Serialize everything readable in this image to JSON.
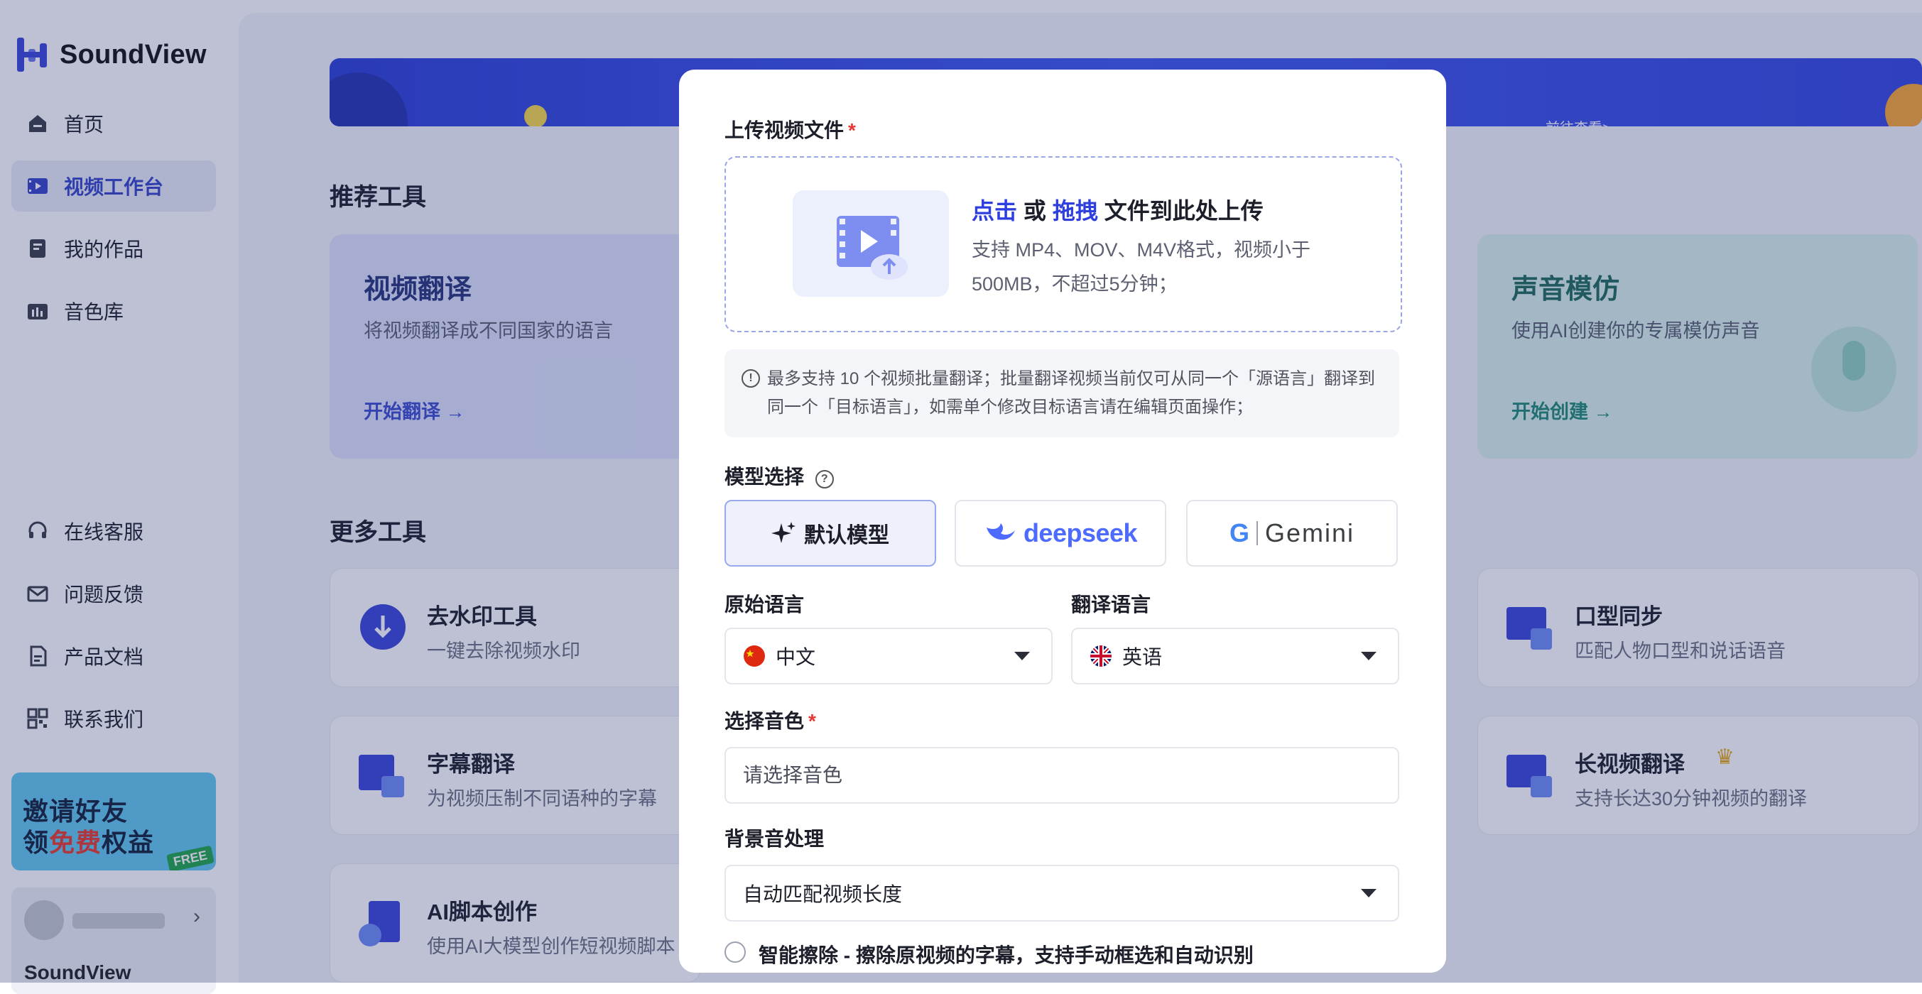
{
  "brand": {
    "name": "SoundView",
    "accent": "#3344c8"
  },
  "sidebar": {
    "nav_top": [
      {
        "label": "首页",
        "icon": "home-icon"
      },
      {
        "label": "视频工作台",
        "icon": "video-workbench-icon",
        "active": true
      },
      {
        "label": "我的作品",
        "icon": "works-icon"
      },
      {
        "label": "音色库",
        "icon": "voice-library-icon"
      }
    ],
    "nav_bottom": [
      {
        "label": "在线客服",
        "icon": "headset-icon"
      },
      {
        "label": "问题反馈",
        "icon": "mail-icon"
      },
      {
        "label": "产品文档",
        "icon": "document-icon"
      },
      {
        "label": "联系我们",
        "icon": "qrcode-icon"
      }
    ],
    "promo": {
      "line1": "邀请好友",
      "line2_pre": "领",
      "line2_hl": "免费",
      "line2_post": "权益",
      "badge": "FREE"
    },
    "user": {
      "name": "SoundView"
    }
  },
  "main": {
    "banner": {
      "link": "前往查看>"
    },
    "recommended": {
      "title": "推荐工具",
      "cards": [
        {
          "title": "视频翻译",
          "desc": "将视频翻译成不同国家的语言",
          "link": "开始翻译 →"
        },
        {
          "title": "声音模仿",
          "desc": "使用AI创建你的专属模仿声音",
          "link": "开始创建 →"
        }
      ]
    },
    "more": {
      "title": "更多工具",
      "left": [
        {
          "title": "去水印工具",
          "desc": "一键去除视频水印"
        },
        {
          "title": "字幕翻译",
          "desc": "为视频压制不同语种的字幕"
        },
        {
          "title": "AI脚本创作",
          "desc": "使用AI大模型创作短视频脚本"
        }
      ],
      "right": [
        {
          "title": "口型同步",
          "desc": "匹配人物口型和说话语音"
        },
        {
          "title": "长视频翻译",
          "desc": "支持长达30分钟视频的翻译"
        }
      ]
    }
  },
  "modal": {
    "upload": {
      "label": "上传视频文件",
      "required": "*",
      "click": "点击",
      "or": " 或 ",
      "drag": "拖拽",
      "rest": " 文件到此处上传",
      "desc": "支持 MP4、MOV、M4V格式，视频小于500MB，不超过5分钟；"
    },
    "notice": "最多支持 10 个视频批量翻译；批量翻译视频当前仅可从同一个「源语言」翻译到同一个「目标语言」，如需单个修改目标语言请在编辑页面操作；",
    "model": {
      "label": "模型选择",
      "options": [
        {
          "label": "默认模型",
          "selected": true
        },
        {
          "label": "deepseek"
        },
        {
          "label": "Gemini"
        }
      ]
    },
    "source_lang": {
      "label": "原始语言",
      "value": "中文"
    },
    "target_lang": {
      "label": "翻译语言",
      "value": "英语"
    },
    "voice": {
      "label": "选择音色",
      "required": "*",
      "placeholder": "请选择音色"
    },
    "bgm": {
      "label": "背景音处理",
      "value": "自动匹配视频长度"
    },
    "erase": {
      "label": "智能擦除 - 擦除原视频的字幕，支持手动框选和自动识别"
    }
  }
}
